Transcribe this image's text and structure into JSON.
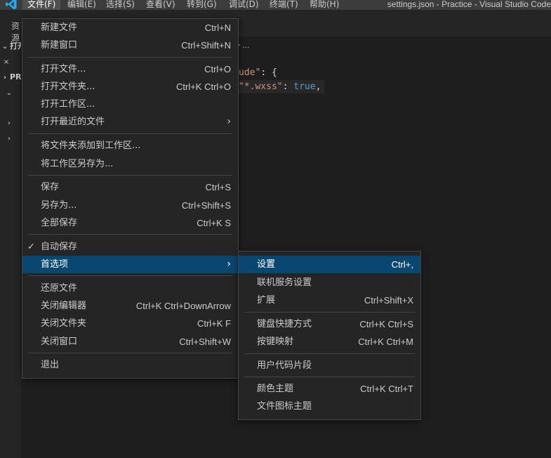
{
  "menubar": {
    "items": [
      "文件(F)",
      "编辑(E)",
      "选择(S)",
      "查看(V)",
      "转到(G)",
      "调试(D)",
      "终端(T)",
      "帮助(H)"
    ],
    "window_title": "settings.json - Practice - Visual Studio Code"
  },
  "sidebar": {
    "header": "资源",
    "section_open": "打开",
    "section_project": "PR",
    "close_glyph": "×"
  },
  "editor": {
    "breadcrumb_suffix": "> ...",
    "lines": [
      {
        "text_key": "ude\"",
        "punc": ": {"
      },
      {
        "text_key": "\"*.wxss\"",
        "punc": ": ",
        "value": "true",
        "trail": ","
      }
    ]
  },
  "file_menu": {
    "items": [
      {
        "label": "新建文件",
        "key": "Ctrl+N"
      },
      {
        "label": "新建窗口",
        "key": "Ctrl+Shift+N"
      },
      {
        "label": "打开文件...",
        "key": "Ctrl+O"
      },
      {
        "label": "打开文件夹...",
        "key": "Ctrl+K Ctrl+O"
      },
      {
        "label": "打开工作区...",
        "key": ""
      },
      {
        "label": "打开最近的文件",
        "key": "",
        "submenu": true
      },
      {
        "label": "将文件夹添加到工作区...",
        "key": ""
      },
      {
        "label": "将工作区另存为...",
        "key": ""
      },
      {
        "label": "保存",
        "key": "Ctrl+S"
      },
      {
        "label": "另存为...",
        "key": "Ctrl+Shift+S"
      },
      {
        "label": "全部保存",
        "key": "Ctrl+K S"
      },
      {
        "label": "自动保存",
        "key": "",
        "checked": true
      },
      {
        "label": "首选项",
        "key": "",
        "submenu": true,
        "selected": true
      },
      {
        "label": "还原文件",
        "key": ""
      },
      {
        "label": "关闭编辑器",
        "key": "Ctrl+K Ctrl+DownArrow"
      },
      {
        "label": "关闭文件夹",
        "key": "Ctrl+K F"
      },
      {
        "label": "关闭窗口",
        "key": "Ctrl+Shift+W"
      },
      {
        "label": "退出",
        "key": ""
      }
    ]
  },
  "preferences_menu": {
    "items": [
      {
        "label": "设置",
        "key": "Ctrl+,",
        "selected": true
      },
      {
        "label": "联机服务设置",
        "key": ""
      },
      {
        "label": "扩展",
        "key": "Ctrl+Shift+X"
      },
      {
        "label": "键盘快捷方式",
        "key": "Ctrl+K Ctrl+S"
      },
      {
        "label": "按键映射",
        "key": "Ctrl+K Ctrl+M"
      },
      {
        "label": "用户代码片段",
        "key": ""
      },
      {
        "label": "颜色主题",
        "key": "Ctrl+K Ctrl+T"
      },
      {
        "label": "文件图标主题",
        "key": ""
      }
    ]
  },
  "glyphs": {
    "check": "✓",
    "submenu_arrow": "›",
    "chevron_down": "⌄",
    "chevron_right": "›"
  },
  "colors": {
    "accent_selection": "#094771",
    "vscode_blue": "#23a9f2"
  }
}
